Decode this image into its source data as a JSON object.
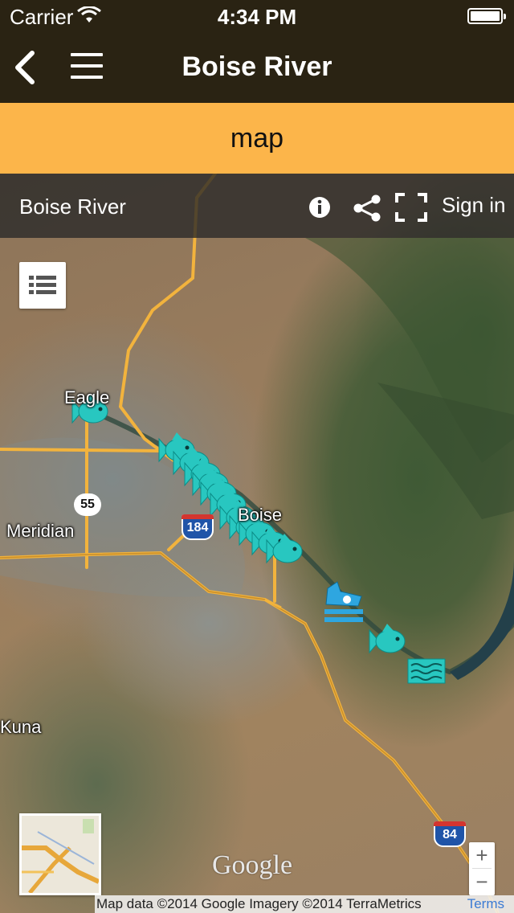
{
  "status_bar": {
    "carrier": "Carrier",
    "time": "4:34 PM"
  },
  "nav": {
    "title": "Boise River"
  },
  "tab": {
    "label": "map"
  },
  "map_header": {
    "name": "Boise River",
    "sign_in": "Sign in"
  },
  "map_labels": {
    "eagle": "Eagle",
    "meridian": "Meridian",
    "boise": "Boise",
    "kuna": "Kuna",
    "route_55": "55",
    "route_184": "184",
    "route_84": "84"
  },
  "map_markers": {
    "fish_color": "#28c7c0",
    "boat_ramp_color": "#2ea6e0",
    "fish_count": 12
  },
  "zoom": {
    "in": "+",
    "out": "−"
  },
  "google_logo": "Google",
  "attribution": {
    "text": "Map data ©2014 Google Imagery ©2014 TerraMetrics",
    "terms": "Terms"
  },
  "colors": {
    "nav_bg": "#2a2313",
    "tab_bg": "#fcb54a",
    "road": "#f2b33d"
  }
}
